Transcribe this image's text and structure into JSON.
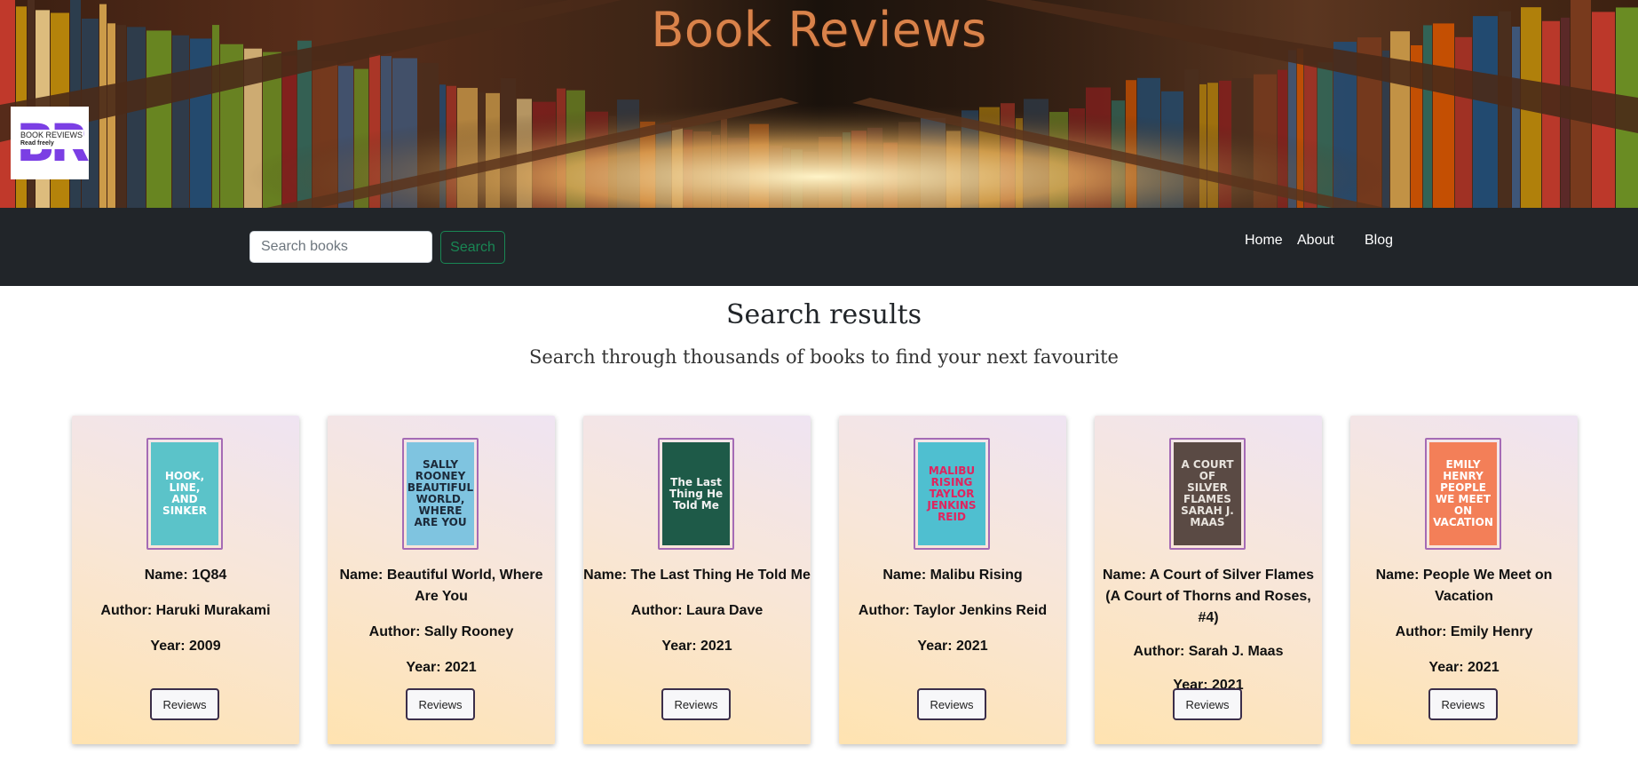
{
  "hero": {
    "title": "Book Reviews",
    "logo_letters": "BR",
    "logo_caption": "BOOK REVIEWS",
    "logo_tagline": "Read freely"
  },
  "navbar": {
    "search_placeholder": "Search books",
    "search_button": "Search",
    "links": [
      "Home",
      "About",
      "Blog"
    ]
  },
  "main": {
    "title": "Search results",
    "subtitle": "Search through thousands of books to find your next favourite"
  },
  "books": [
    {
      "name": "Name: 1Q84",
      "author": "Author: Haruki Murakami",
      "year": "Year: 2009",
      "cover_text": "HOOK, LINE, AND SINKER",
      "cover_bg": "#5bc3c9",
      "cover_fg": "#ffffff",
      "button": "Reviews"
    },
    {
      "name": "Name: Beautiful World, Where Are You",
      "author": "Author: Sally Rooney",
      "year": "Year: 2021",
      "cover_text": "SALLY ROONEY BEAUTIFUL WORLD, WHERE ARE YOU",
      "cover_bg": "#7fc4e0",
      "cover_fg": "#1c2a3a",
      "button": "Reviews"
    },
    {
      "name": "Name: The Last Thing He Told Me",
      "author": "Author: Laura Dave",
      "year": "Year: 2021",
      "cover_text": "The Last Thing He Told Me",
      "cover_bg": "#1e5a48",
      "cover_fg": "#f2f2f2",
      "button": "Reviews"
    },
    {
      "name": "Name: Malibu Rising",
      "author": "Author: Taylor Jenkins Reid",
      "year": "Year: 2021",
      "cover_text": "MALIBU RISING TAYLOR JENKINS REID",
      "cover_bg": "#4fbfd0",
      "cover_fg": "#e0245e",
      "button": "Reviews"
    },
    {
      "name": "Name: A Court of Silver Flames (A Court of Thorns and Roses, #4)",
      "author": "Author: Sarah J. Maas",
      "year": "Year: 2021",
      "cover_text": "A COURT OF SILVER FLAMES SARAH J. MAAS",
      "cover_bg": "#5a4a44",
      "cover_fg": "#e8e3dd",
      "button": "Reviews"
    },
    {
      "name": "Name: People We Meet on Vacation",
      "author": "Author: Emily Henry",
      "year": "Year: 2021",
      "cover_text": "EMILY HENRY PEOPLE WE MEET ON VACATION",
      "cover_bg": "#f37f58",
      "cover_fg": "#ffffff",
      "button": "Reviews"
    }
  ]
}
